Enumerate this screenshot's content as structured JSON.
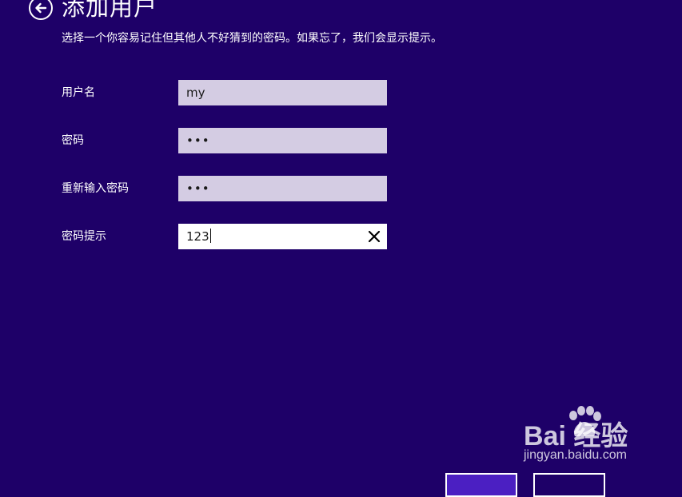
{
  "header": {
    "title": "添加用户",
    "subtitle": "选择一个你容易记住但其他人不好猜到的密码。如果忘了，我们会显示提示。"
  },
  "form": {
    "username": {
      "label": "用户名",
      "value": "my"
    },
    "password": {
      "label": "密码",
      "value": "•••"
    },
    "confirm_password": {
      "label": "重新输入密码",
      "value": "•••"
    },
    "password_hint": {
      "label": "密码提示",
      "value": "123"
    }
  },
  "watermark": {
    "logo_text": "Bai  经验",
    "url": "jingyan.baidu.com"
  },
  "colors": {
    "background": "#1e0068",
    "field_inactive": "#d4cce3",
    "field_active": "#ffffff",
    "primary_button": "#4b1fc2"
  }
}
